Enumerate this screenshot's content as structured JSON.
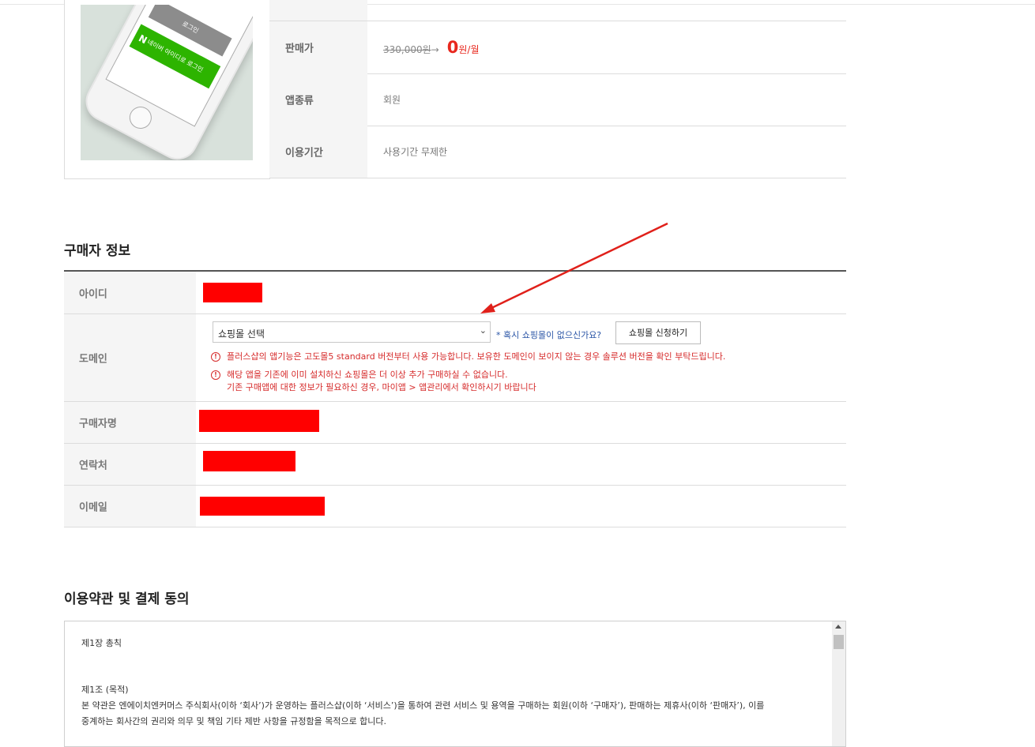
{
  "product": {
    "image_texts": {
      "gray_button": "로그인",
      "green_button": "네이버 아이디로 로그인",
      "green_logo": "N"
    },
    "rows": [
      {
        "label": "판매가"
      },
      {
        "label": "앱종류",
        "value": "회원"
      },
      {
        "label": "이용기간",
        "value": "사용기간 무제한"
      }
    ],
    "price": {
      "original": "330,000원",
      "arrow": "→",
      "sale": "0",
      "unit": "원/월"
    }
  },
  "buyer_info": {
    "title": "구매자 정보",
    "id_label": "아이디",
    "domain_label": "도메인",
    "domain_select_value": "쇼핑몰 선택",
    "no_shop_link": "* 혹시 쇼핑몰이 없으신가요?",
    "apply_button": "쇼핑몰 신청하기",
    "notice1": "플러스샵의 앱기능은 고도몰5 standard 버전부터 사용 가능합니다. 보유한 도메인이 보이지 않는 경우 솔루션 버전을 확인 부탁드립니다.",
    "notice2_line1": "해당 앱을 기존에 이미 설치하신 쇼핑몰은 더 이상 추가 구매하실 수 없습니다.",
    "notice2_line2": "기존 구매앱에 대한 정보가 필요하신 경우, 마이앱 > 앱관리에서 확인하시기 바랍니다",
    "name_label": "구매자명",
    "contact_label": "연락처",
    "email_label": "이메일"
  },
  "terms": {
    "title": "이용약관 및 결제 동의",
    "chapter": "제1장 총칙",
    "article": "제1조 (목적)",
    "body1": "본 약관은 엔에이치엔커머스 주식회사(이하 ‘회사’)가 운영하는 플러스샵(이하 ‘서비스’)을 통하여 관련 서비스 및 용역을 구매하는 회원(이하 ‘구매자’), 판매하는 제휴사(이하 ‘판매자’), 이를",
    "body2": "중계하는 회사간의 권리와 의무 및 책임 기타 제반 사항을 규정함을 목적으로 합니다."
  },
  "colors": {
    "accent_red": "#e8281e",
    "notice_red": "#d62b2b",
    "link_blue": "#2a55a6",
    "naver_green": "#2db400",
    "redaction": "#ff0000"
  }
}
